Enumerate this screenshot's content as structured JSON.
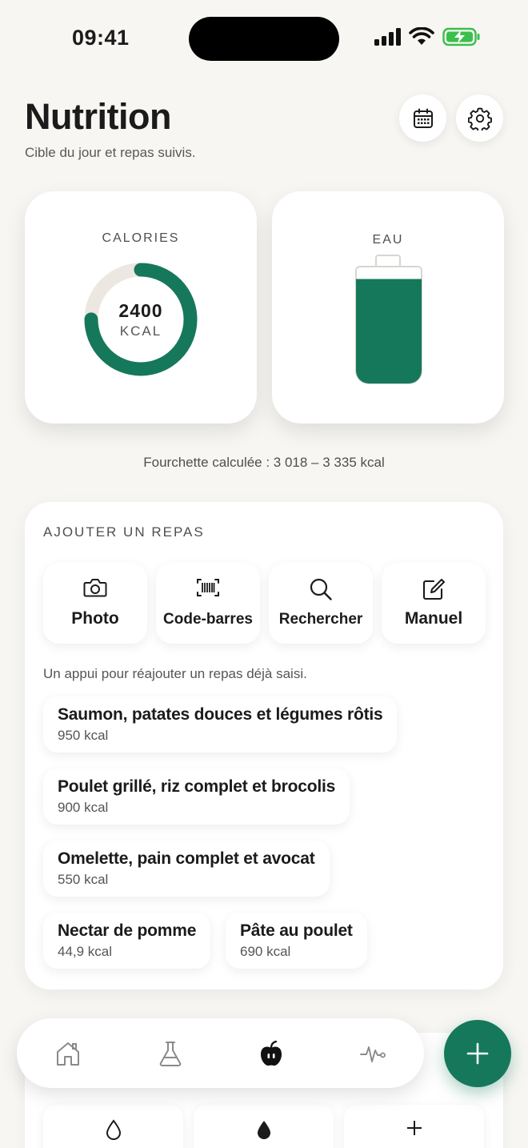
{
  "status_bar": {
    "time": "09:41"
  },
  "header": {
    "title": "Nutrition",
    "subtitle": "Cible du jour et repas suivis.",
    "calendar_icon": "calendar-icon",
    "settings_icon": "gear-icon"
  },
  "calories_card": {
    "label": "CALORIES",
    "value": "2400",
    "unit": "KCAL",
    "progress": 0.75
  },
  "water_card": {
    "label": "EAU",
    "fill_level": 0.9
  },
  "range_text": "Fourchette calculée : 3 018 – 3 335 kcal",
  "add_meal": {
    "title": "AJOUTER UN REPAS",
    "actions": [
      {
        "label": "Photo",
        "icon": "camera-icon"
      },
      {
        "label": "Code-barres",
        "icon": "barcode-icon"
      },
      {
        "label": "Rechercher",
        "icon": "search-icon"
      },
      {
        "label": "Manuel",
        "icon": "edit-icon"
      }
    ],
    "hint": "Un appui pour réajouter un repas déjà saisi.",
    "recent_meals": [
      {
        "name": "Saumon, patates douces et légumes rôtis",
        "kcal": "950 kcal"
      },
      {
        "name": "Poulet grillé, riz complet et brocolis",
        "kcal": "900 kcal"
      },
      {
        "name": "Omelette, pain complet et avocat",
        "kcal": "550 kcal"
      },
      {
        "name": "Nectar de pomme",
        "kcal": "44,9 kcal"
      },
      {
        "name": "Pâte au poulet",
        "kcal": "690 kcal"
      }
    ]
  },
  "tab_bar": {
    "items": [
      {
        "icon": "home-icon",
        "active": false
      },
      {
        "icon": "flask-icon",
        "active": false
      },
      {
        "icon": "apple-icon",
        "active": true
      },
      {
        "icon": "pulse-icon",
        "active": false
      }
    ],
    "fab_icon": "plus-icon"
  },
  "colors": {
    "accent": "#16785a",
    "background": "#f7f6f3",
    "ring_track": "#ece8e1"
  }
}
